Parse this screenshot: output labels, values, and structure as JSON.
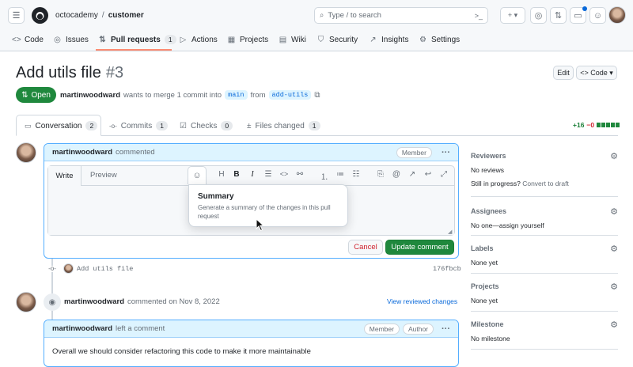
{
  "header": {
    "org": "octocademy",
    "separator": "/",
    "repo": "customer",
    "search_placeholder": "Type / to search",
    "search_slash": "/",
    "plus_label": "+ ▾"
  },
  "nav": [
    {
      "icon": "<>",
      "label": "Code"
    },
    {
      "icon": "◎",
      "label": "Issues"
    },
    {
      "icon": "⇅",
      "label": "Pull requests",
      "count": "1"
    },
    {
      "icon": "▷",
      "label": "Actions"
    },
    {
      "icon": "▦",
      "label": "Projects"
    },
    {
      "icon": "▤",
      "label": "Wiki"
    },
    {
      "icon": "⛉",
      "label": "Security"
    },
    {
      "icon": "↗",
      "label": "Insights"
    },
    {
      "icon": "⚙",
      "label": "Settings"
    }
  ],
  "pr": {
    "title": "Add utils file",
    "number": "#3",
    "state": "Open",
    "state_icon": "⇅",
    "author": "martinwoodward",
    "merge_text": "wants to merge 1 commit into",
    "base_branch": "main",
    "from_text": "from",
    "head_branch": "add-utils",
    "edit_label": "Edit",
    "code_label": "<> Code ▾"
  },
  "tabs": [
    {
      "icon": "💬",
      "label": "Conversation",
      "count": "2"
    },
    {
      "icon": "-o-",
      "label": "Commits",
      "count": "1"
    },
    {
      "icon": "☑",
      "label": "Checks",
      "count": "0"
    },
    {
      "icon": "±",
      "label": "Files changed",
      "count": "1"
    }
  ],
  "diffstat": {
    "plus": "+16",
    "minus": "−0"
  },
  "comment1": {
    "author": "martinwoodward",
    "action": "commented",
    "badge": "Member",
    "write_tab": "Write",
    "preview_tab": "Preview",
    "cancel_label": "Cancel",
    "update_label": "Update comment"
  },
  "tooltip": {
    "title": "Summary",
    "description": "Generate a summary of the changes in this pull request"
  },
  "commit": {
    "message": "Add utils file",
    "sha": "176fbcb"
  },
  "event": {
    "author": "martinwoodward",
    "action": "commented on Nov 8, 2022",
    "link": "View reviewed changes"
  },
  "comment2": {
    "author": "martinwoodward",
    "action": "left a comment",
    "badge1": "Member",
    "badge2": "Author",
    "body": "Overall we should consider refactoring this code to make it more maintainable"
  },
  "sidebar": {
    "reviewers_title": "Reviewers",
    "reviewers_value": "No reviews",
    "progress_text": "Still in progress?",
    "progress_link": "Convert to draft",
    "assignees_title": "Assignees",
    "assignees_value": "No one—",
    "assignees_link": "assign yourself",
    "labels_title": "Labels",
    "labels_value": "None yet",
    "projects_title": "Projects",
    "projects_value": "None yet",
    "milestone_title": "Milestone",
    "milestone_value": "No milestone"
  },
  "colors": {
    "open_green": "#1f883d",
    "link_blue": "#0969da",
    "danger_red": "#cf222e",
    "accent_orange": "#fd8c73"
  }
}
